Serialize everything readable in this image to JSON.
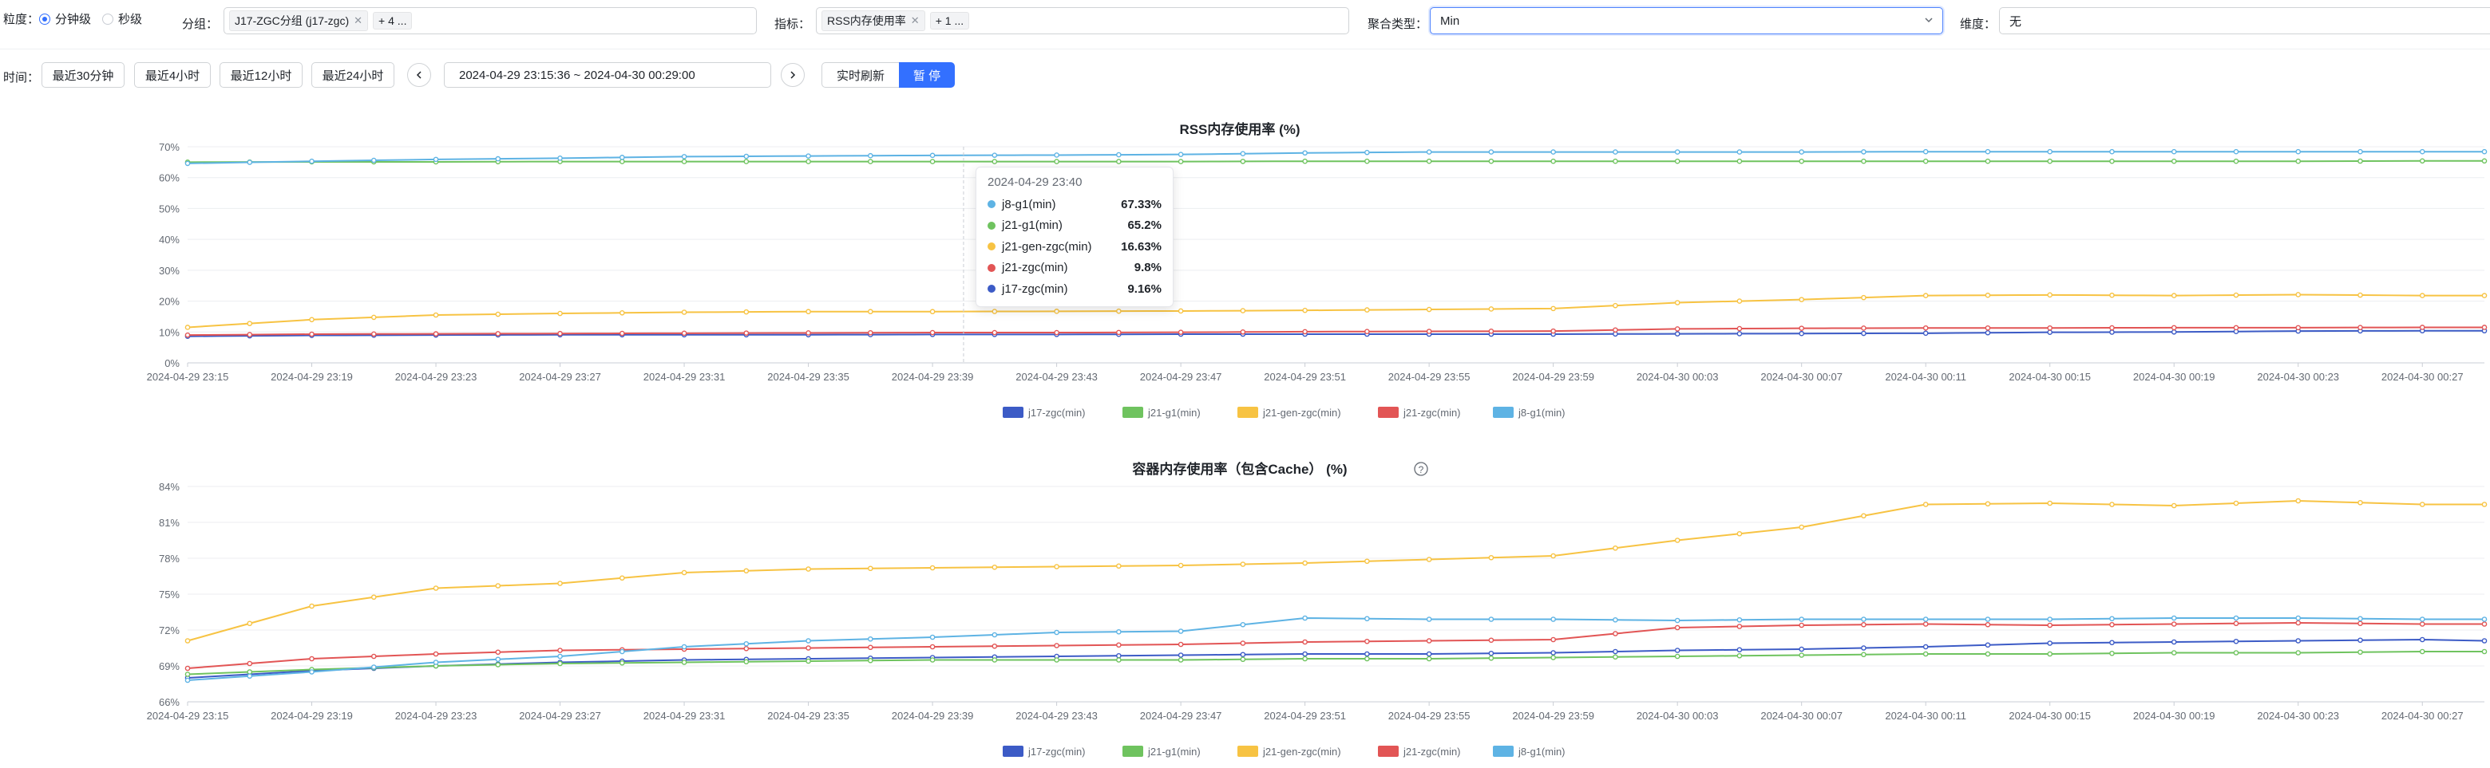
{
  "filters": {
    "granularity_label": "粒度：",
    "granularity_options": [
      "分钟级",
      "秒级"
    ],
    "granularity_selected": 0,
    "group_label": "分组：",
    "group_tag": "J17-ZGC分组 (j17-zgc)",
    "group_more": "+ 4 ...",
    "metric_label": "指标：",
    "metric_tag": "RSS内存使用率",
    "metric_more": "+ 1 ...",
    "agg_label": "聚合类型：",
    "agg_value": "Min",
    "dim_label": "维度：",
    "dim_value": "无"
  },
  "time_bar": {
    "label": "时间：",
    "quick": [
      "最近30分钟",
      "最近4小时",
      "最近12小时",
      "最近24小时"
    ],
    "range": "2024-04-29 23:15:36  ~  2024-04-30 00:29:00",
    "refresh": "实时刷新",
    "pause": "暂 停"
  },
  "colors": {
    "j17-zgc(min)": "#3c5bc6",
    "j21-g1(min)": "#6fc35f",
    "j21-gen-zgc(min)": "#f7c343",
    "j21-zgc(min)": "#e25555",
    "j8-g1(min)": "#5eb3e4"
  },
  "legend": [
    "j17-zgc(min)",
    "j21-g1(min)",
    "j21-gen-zgc(min)",
    "j21-zgc(min)",
    "j8-g1(min)"
  ],
  "x_ticks": [
    "2024-04-29 23:15",
    "2024-04-29 23:19",
    "2024-04-29 23:23",
    "2024-04-29 23:27",
    "2024-04-29 23:31",
    "2024-04-29 23:35",
    "2024-04-29 23:39",
    "2024-04-29 23:43",
    "2024-04-29 23:47",
    "2024-04-29 23:51",
    "2024-04-29 23:55",
    "2024-04-29 23:59",
    "2024-04-30 00:03",
    "2024-04-30 00:07",
    "2024-04-30 00:11",
    "2024-04-30 00:15",
    "2024-04-30 00:19",
    "2024-04-30 00:23",
    "2024-04-30 00:27"
  ],
  "tooltip": {
    "title": "2024-04-29 23:40",
    "rows": [
      {
        "name": "j8-g1(min)",
        "value": "67.33%"
      },
      {
        "name": "j21-g1(min)",
        "value": "65.2%"
      },
      {
        "name": "j21-gen-zgc(min)",
        "value": "16.63%"
      },
      {
        "name": "j21-zgc(min)",
        "value": "9.8%"
      },
      {
        "name": "j17-zgc(min)",
        "value": "9.16%"
      }
    ]
  },
  "chart_data": [
    {
      "type": "line",
      "title": "RSS内存使用率 (%)",
      "y_ticks": [
        "0%",
        "10%",
        "20%",
        "30%",
        "40%",
        "50%",
        "60%",
        "70%"
      ],
      "ylim": [
        0,
        70
      ],
      "x": [
        "23:15",
        "23:19",
        "23:23",
        "23:27",
        "23:31",
        "23:35",
        "23:39",
        "23:43",
        "23:47",
        "23:51",
        "23:55",
        "23:59",
        "00:03",
        "00:07",
        "00:11",
        "00:15",
        "00:19",
        "00:23",
        "00:27",
        "00:29"
      ],
      "series": [
        {
          "name": "j17-zgc(min)",
          "values": [
            8.6,
            8.9,
            9.0,
            9.1,
            9.1,
            9.1,
            9.2,
            9.2,
            9.3,
            9.3,
            9.3,
            9.3,
            9.4,
            9.5,
            9.6,
            9.9,
            10.0,
            10.3,
            10.4,
            10.4
          ]
        },
        {
          "name": "j21-g1(min)",
          "values": [
            65.0,
            65.1,
            65.1,
            65.2,
            65.2,
            65.2,
            65.2,
            65.2,
            65.2,
            65.3,
            65.3,
            65.3,
            65.3,
            65.3,
            65.3,
            65.3,
            65.3,
            65.3,
            65.4,
            65.4
          ]
        },
        {
          "name": "j21-gen-zgc(min)",
          "values": [
            11.5,
            14.0,
            15.5,
            16.0,
            16.4,
            16.6,
            16.6,
            16.7,
            16.8,
            17.0,
            17.3,
            17.6,
            19.5,
            20.5,
            21.8,
            22.0,
            21.8,
            22.1,
            21.8,
            21.8
          ]
        },
        {
          "name": "j21-zgc(min)",
          "values": [
            9.0,
            9.3,
            9.4,
            9.5,
            9.6,
            9.7,
            9.8,
            9.8,
            9.9,
            10.1,
            10.2,
            10.3,
            11.0,
            11.2,
            11.3,
            11.3,
            11.4,
            11.4,
            11.5,
            11.5
          ]
        },
        {
          "name": "j8-g1(min)",
          "values": [
            64.6,
            65.3,
            65.9,
            66.3,
            66.8,
            67.0,
            67.2,
            67.3,
            67.5,
            68.0,
            68.3,
            68.3,
            68.3,
            68.3,
            68.4,
            68.4,
            68.4,
            68.4,
            68.4,
            68.4
          ]
        }
      ]
    },
    {
      "type": "line",
      "title": "容器内存使用率（包含Cache） (%)",
      "y_ticks": [
        "66%",
        "69%",
        "72%",
        "75%",
        "78%",
        "81%",
        "84%"
      ],
      "ylim": [
        66,
        84
      ],
      "x": [
        "23:15",
        "23:19",
        "23:23",
        "23:27",
        "23:31",
        "23:35",
        "23:39",
        "23:43",
        "23:47",
        "23:51",
        "23:55",
        "23:59",
        "00:03",
        "00:07",
        "00:11",
        "00:15",
        "00:19",
        "00:23",
        "00:27",
        "00:29"
      ],
      "series": [
        {
          "name": "j17-zgc(min)",
          "values": [
            68.0,
            68.6,
            69.0,
            69.3,
            69.5,
            69.6,
            69.7,
            69.8,
            69.9,
            70.0,
            70.0,
            70.1,
            70.3,
            70.4,
            70.6,
            70.9,
            71.0,
            71.1,
            71.2,
            71.1
          ]
        },
        {
          "name": "j21-g1(min)",
          "values": [
            68.3,
            68.7,
            69.0,
            69.2,
            69.3,
            69.4,
            69.5,
            69.5,
            69.5,
            69.6,
            69.6,
            69.7,
            69.8,
            69.9,
            70.0,
            70.0,
            70.1,
            70.1,
            70.2,
            70.2
          ]
        },
        {
          "name": "j21-gen-zgc(min)",
          "values": [
            71.1,
            74.0,
            75.5,
            75.9,
            76.8,
            77.1,
            77.2,
            77.3,
            77.4,
            77.6,
            77.9,
            78.2,
            79.5,
            80.6,
            82.5,
            82.6,
            82.4,
            82.8,
            82.5,
            82.5
          ]
        },
        {
          "name": "j21-zgc(min)",
          "values": [
            68.8,
            69.6,
            70.0,
            70.3,
            70.4,
            70.5,
            70.6,
            70.7,
            70.8,
            71.0,
            71.1,
            71.2,
            72.2,
            72.4,
            72.5,
            72.4,
            72.5,
            72.6,
            72.5,
            72.5
          ]
        },
        {
          "name": "j8-g1(min)",
          "values": [
            67.8,
            68.5,
            69.3,
            69.8,
            70.6,
            71.1,
            71.4,
            71.8,
            71.9,
            73.0,
            72.9,
            72.9,
            72.8,
            72.9,
            72.9,
            72.9,
            73.0,
            73.0,
            72.9,
            72.9
          ]
        }
      ]
    }
  ]
}
